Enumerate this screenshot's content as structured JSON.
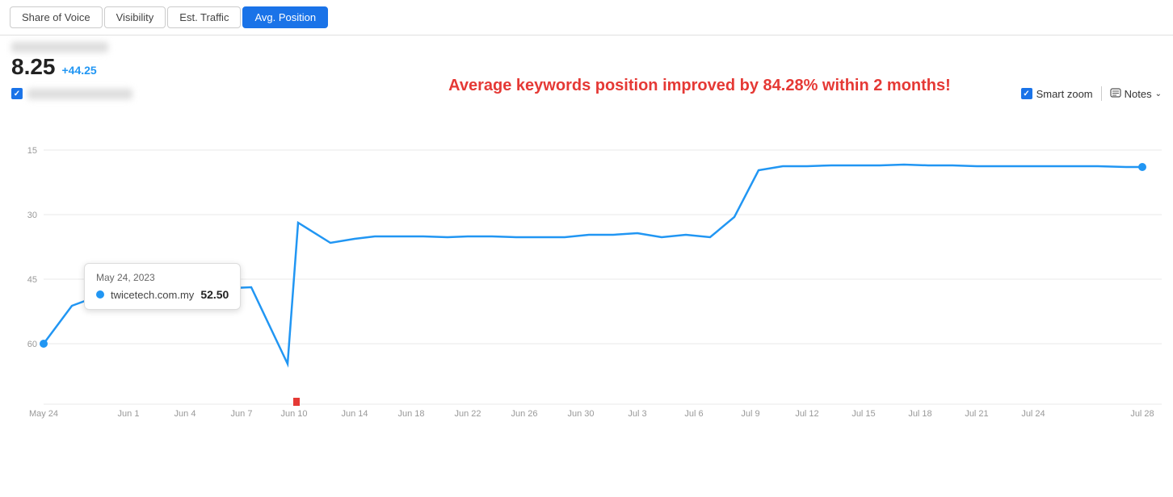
{
  "tabs": [
    {
      "label": "Share of Voice",
      "active": false
    },
    {
      "label": "Visibility",
      "active": false
    },
    {
      "label": "Est. Traffic",
      "active": false
    },
    {
      "label": "Avg. Position",
      "active": true
    }
  ],
  "metric": {
    "label_blurred": true,
    "value": "8.25",
    "change": "+44.25"
  },
  "banner": {
    "text": "Average keywords position improved by 84.28% within 2 months!"
  },
  "legend": {
    "checked": true,
    "label_blurred": true
  },
  "controls": {
    "smart_zoom_label": "Smart zoom",
    "notes_label": "Notes"
  },
  "tooltip": {
    "date": "May 24, 2023",
    "domain": "twicetech.com.my",
    "value": "52.50"
  },
  "y_axis": [
    "15",
    "30",
    "45",
    "60"
  ],
  "x_axis": [
    "May 24",
    "Jun 1",
    "Jun 4",
    "Jun 7",
    "Jun 10",
    "Jun 14",
    "Jun 18",
    "Jun 22",
    "Jun 26",
    "Jun 30",
    "Jul 3",
    "Jul 6",
    "Jul 9",
    "Jul 12",
    "Jul 15",
    "Jul 18",
    "Jul 21",
    "Jul 24",
    "Jul 28"
  ]
}
